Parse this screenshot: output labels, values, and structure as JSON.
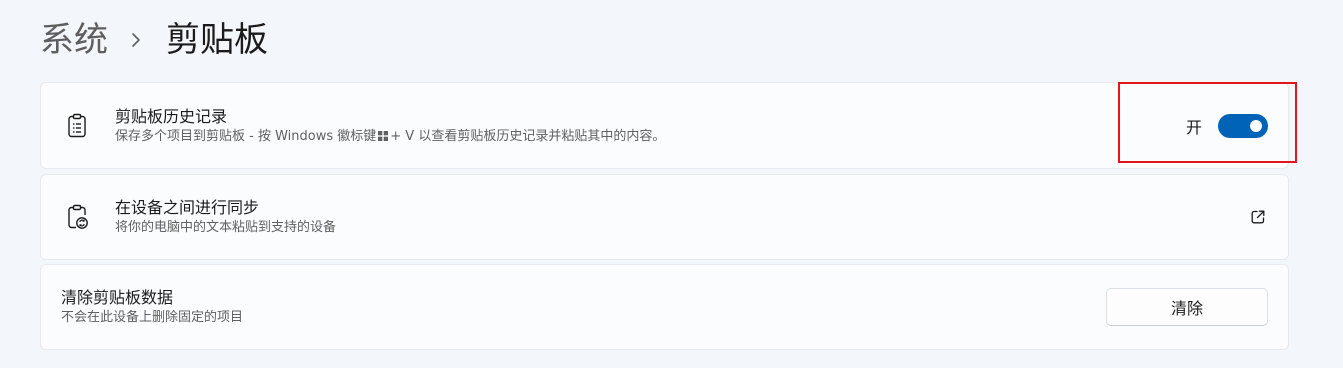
{
  "breadcrumb": {
    "parent": "系统",
    "separator_icon": "chevron-right-icon",
    "current": "剪贴板"
  },
  "clipboard_history": {
    "icon": "clipboard-list-icon",
    "title": "剪贴板历史记录",
    "description_before_key": "保存多个项目到剪贴板 - 按 Windows 徽标键",
    "key_icon": "windows-logo-icon",
    "description_after_key": "+ V 以查看剪贴板历史记录并粘贴其中的内容。",
    "toggle_state_label": "开",
    "toggle_on": true
  },
  "sync": {
    "icon": "clipboard-sync-icon",
    "title": "在设备之间进行同步",
    "description": "将你的电脑中的文本粘贴到支持的设备",
    "link_icon": "external-link-icon"
  },
  "clear": {
    "title": "清除剪贴板数据",
    "description": "不会在此设备上删除固定的项目",
    "button_label": "清除"
  },
  "colors": {
    "accent": "#0063b8",
    "highlight": "#e0161b",
    "background": "#f3f6fa",
    "card": "#fbfcfd"
  }
}
